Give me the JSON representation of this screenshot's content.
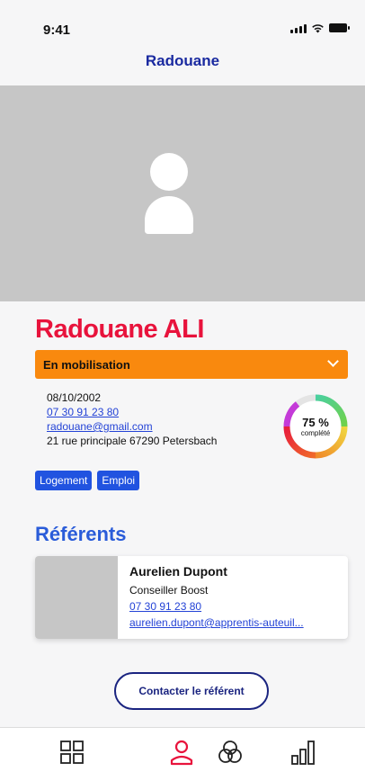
{
  "status_bar": {
    "time": "9:41"
  },
  "header": {
    "title": "Radouane"
  },
  "profile": {
    "full_name": "Radouane ALI",
    "status": "En mobilisation",
    "birthdate": "08/10/2002",
    "phone": "07 30 91 23 80",
    "email": "radouane@gmail.com",
    "address": "21 rue principale 67290 Petersbach",
    "completion_percent": 75,
    "completion_label": "75 %",
    "completion_caption": "complété",
    "tags": [
      "Logement",
      "Emploi"
    ]
  },
  "referents": {
    "title": "Référents",
    "items": [
      {
        "name": "Aurelien Dupont",
        "role": "Conseiller Boost",
        "phone": "07 30 91 23 80",
        "email": "aurelien.dupont@apprentis-auteuil..."
      }
    ]
  },
  "actions": {
    "contact_label": "Contacter le référent"
  },
  "tabbar": {
    "items": [
      {
        "icon": "grid-icon",
        "active": false
      },
      {
        "icon": "profile-icon",
        "active": true
      },
      {
        "icon": "circles-icon",
        "active": false
      },
      {
        "icon": "chart-icon",
        "active": false
      }
    ]
  },
  "colors": {
    "accent": "#e8133c",
    "status": "#f9890e",
    "link": "#2443d6",
    "tag": "#2153e0",
    "navy": "#1a2480"
  }
}
